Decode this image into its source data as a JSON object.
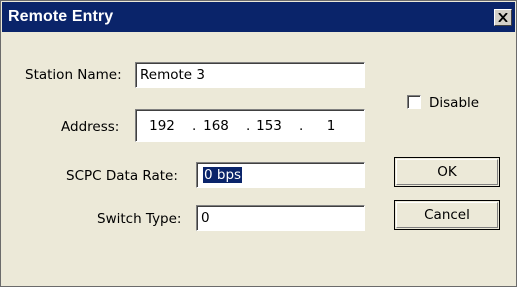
{
  "window": {
    "title": "Remote Entry"
  },
  "fields": {
    "station_name": {
      "label": "Station Name:",
      "value": "Remote 3"
    },
    "address": {
      "label": "Address:",
      "octets": [
        "192",
        "168",
        "153",
        "1"
      ]
    },
    "scpc_data_rate": {
      "label": "SCPC Data Rate:",
      "value": "0 bps"
    },
    "switch_type": {
      "label": "Switch Type:",
      "value": "0"
    }
  },
  "disable": {
    "label": "Disable",
    "checked": false
  },
  "buttons": {
    "ok": "OK",
    "cancel": "Cancel"
  },
  "icons": {
    "close": "close-icon"
  }
}
